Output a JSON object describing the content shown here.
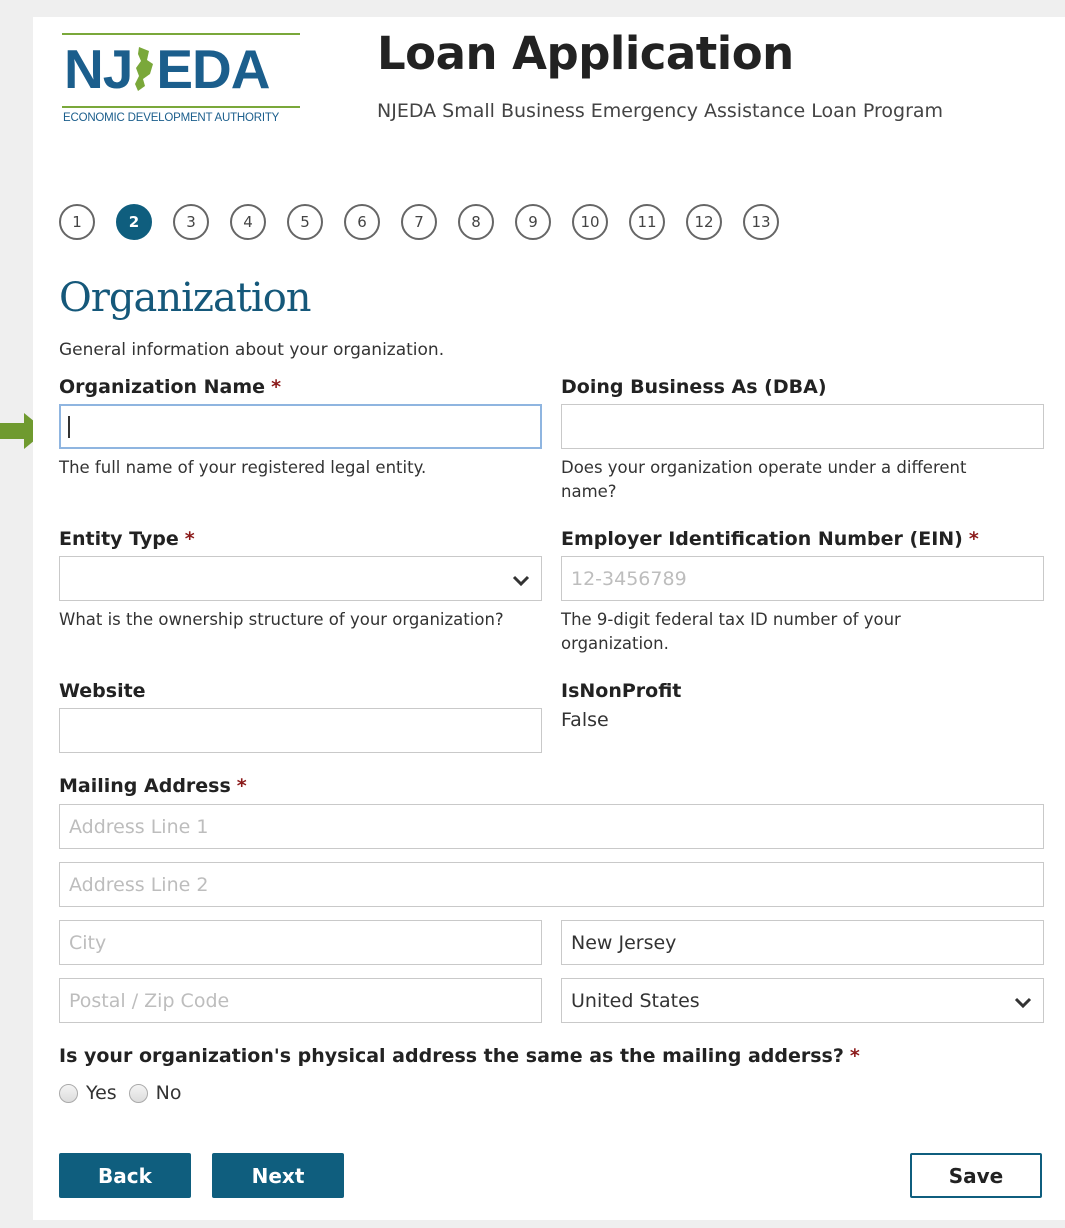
{
  "header": {
    "logo_text": "NJ EDA",
    "logo_subtext": "ECONOMIC DEVELOPMENT AUTHORITY",
    "title": "Loan Application",
    "subtitle": "NJEDA Small Business Emergency Assistance Loan Program"
  },
  "stepper": {
    "steps": [
      "1",
      "2",
      "3",
      "4",
      "5",
      "6",
      "7",
      "8",
      "9",
      "10",
      "11",
      "12",
      "13"
    ],
    "active_step": "2"
  },
  "section": {
    "title": "Organization",
    "description": "General information about your organization."
  },
  "fields": {
    "org_name": {
      "label": "Organization Name",
      "required_mark": "*",
      "value": "",
      "help": "The full name of your registered legal entity."
    },
    "dba": {
      "label": "Doing Business As (DBA)",
      "value": "",
      "help": "Does your organization operate under a different name?"
    },
    "entity_type": {
      "label": "Entity Type",
      "required_mark": "*",
      "value": "",
      "help": "What is the ownership structure of your organization?"
    },
    "ein": {
      "label": "Employer Identification Number (EIN)",
      "required_mark": "*",
      "placeholder": "12-3456789",
      "help": "The 9-digit federal tax ID number of your organization."
    },
    "website": {
      "label": "Website",
      "value": ""
    },
    "is_nonprofit": {
      "label": "IsNonProfit",
      "value": "False"
    },
    "mailing_address": {
      "label": "Mailing Address",
      "required_mark": "*",
      "line1_placeholder": "Address Line 1",
      "line2_placeholder": "Address Line 2",
      "city_placeholder": "City",
      "state_value": "New Jersey",
      "zip_placeholder": "Postal / Zip Code",
      "country_value": "United States"
    },
    "physical_same": {
      "question": "Is your organization's physical address the same as the mailing adderss?",
      "required_mark": "*",
      "options": [
        "Yes",
        "No"
      ]
    }
  },
  "actions": {
    "back_label": "Back",
    "next_label": "Next",
    "save_label": "Save"
  },
  "colors": {
    "brand_primary": "#0f5e7e",
    "title_blue": "#15587a",
    "required_red": "#8b1a1a",
    "annotation_arrow": "#6f9a2f"
  },
  "icons": {
    "select_chevron": "chevron-down-icon",
    "annotation": "arrow-icon"
  }
}
